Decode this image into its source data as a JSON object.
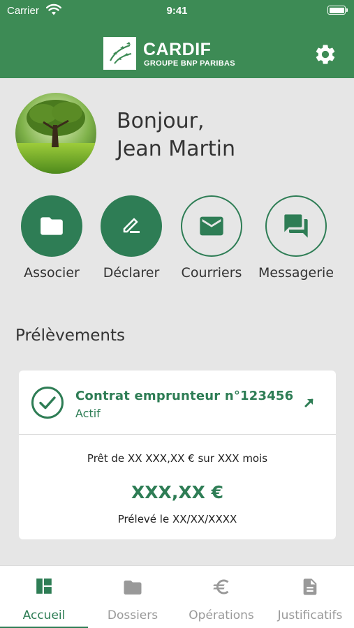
{
  "status_bar": {
    "carrier": "Carrier",
    "time": "9:41"
  },
  "header": {
    "brand": "CARDIF",
    "brand_sub": "GROUPE BNP PARIBAS",
    "settings_icon": "gear-icon",
    "accent_color": "#3d8b55"
  },
  "greeting": {
    "line1": "Bonjour,",
    "line2": "Jean Martin"
  },
  "actions": [
    {
      "label": "Associer",
      "icon": "folder-icon",
      "style": "filled"
    },
    {
      "label": "Déclarer",
      "icon": "edit-icon",
      "style": "filled"
    },
    {
      "label": "Courriers",
      "icon": "mail-icon",
      "style": "outline"
    },
    {
      "label": "Messagerie",
      "icon": "chat-icon",
      "style": "outline"
    }
  ],
  "section": {
    "title": "Prélèvements"
  },
  "card": {
    "title": "Contrat emprunteur n°123456",
    "status": "Actif",
    "loan": "Prêt de XX XXX,XX € sur XXX mois",
    "amount": "XXX,XX €",
    "debit": "Prélevé le XX/XX/XXXX"
  },
  "tabs": [
    {
      "label": "Accueil",
      "icon": "dashboard-icon",
      "active": true
    },
    {
      "label": "Dossiers",
      "icon": "folder-icon",
      "active": false
    },
    {
      "label": "Opérations",
      "icon": "euro-icon",
      "active": false
    },
    {
      "label": "Justificatifs",
      "icon": "document-icon",
      "active": false
    }
  ]
}
